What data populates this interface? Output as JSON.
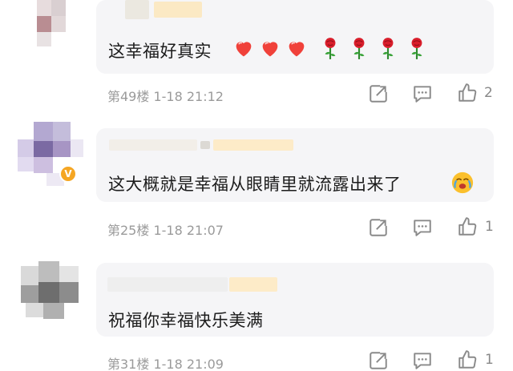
{
  "comments": [
    {
      "text": "这幸福好真实",
      "floor": "第49楼",
      "date": "1-18",
      "time": "21:12",
      "likes": "2",
      "emojis": [
        "heart-icon",
        "heart-icon",
        "heart-icon",
        "rose-icon",
        "rose-icon",
        "rose-icon",
        "rose-icon"
      ]
    },
    {
      "text": "这大概就是幸福从眼睛里就流露出来了",
      "floor": "第25楼",
      "date": "1-18",
      "time": "21:07",
      "likes": "1",
      "emojis": [
        "tearful-face-icon"
      ],
      "verified": true
    },
    {
      "text": "祝福你幸福快乐美满",
      "floor": "第31楼",
      "date": "1-18",
      "time": "21:09",
      "likes": "1",
      "emojis": []
    }
  ],
  "colors": {
    "bubble": "#f5f5f7",
    "meta": "#9a9a9a",
    "icon": "#8a8a8a",
    "heart": "#f0413a",
    "rose": "#d91e2b",
    "badge": "#f5a623"
  }
}
